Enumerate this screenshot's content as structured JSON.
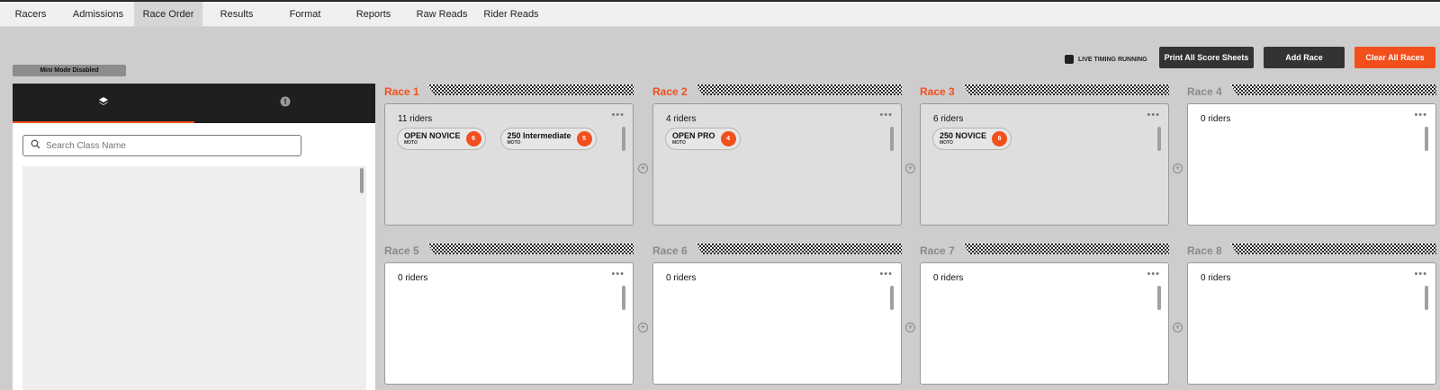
{
  "nav": {
    "items": [
      "Racers",
      "Admissions",
      "Race Order",
      "Results",
      "Format",
      "Reports",
      "Raw Reads",
      "Rider Reads"
    ],
    "active": "Race Order"
  },
  "mini_mode_label": "Mini Mode Disabled",
  "live_timing": {
    "label": "LIVE TIMING RUNNING",
    "checked": true
  },
  "toolbar": {
    "print_label": "Print All Score Sheets",
    "add_label": "Add Race",
    "clear_label": "Clear All Races"
  },
  "sidebar": {
    "tabs": [
      {
        "icon": "layers-icon"
      },
      {
        "icon": "info-icon"
      }
    ],
    "search_placeholder": "Search Class Name"
  },
  "races": [
    {
      "title": "Race 1",
      "riders": "11 riders",
      "classes": [
        {
          "name": "OPEN NOVICE",
          "type": "MOTO",
          "count": "6"
        },
        {
          "name": "250 Intermediate",
          "type": "MOTO",
          "count": "5"
        }
      ]
    },
    {
      "title": "Race 2",
      "riders": "4 riders",
      "classes": [
        {
          "name": "OPEN PRO",
          "type": "MOTO",
          "count": "4"
        }
      ]
    },
    {
      "title": "Race 3",
      "riders": "6 riders",
      "classes": [
        {
          "name": "250 NOVICE",
          "type": "MOTO",
          "count": "6"
        }
      ]
    },
    {
      "title": "Race 4",
      "riders": "0 riders",
      "classes": []
    },
    {
      "title": "Race 5",
      "riders": "0 riders",
      "classes": []
    },
    {
      "title": "Race 6",
      "riders": "0 riders",
      "classes": []
    },
    {
      "title": "Race 7",
      "riders": "0 riders",
      "classes": []
    },
    {
      "title": "Race 8",
      "riders": "0 riders",
      "classes": []
    }
  ],
  "colors": {
    "accent": "#f24f1c",
    "dark": "#333333",
    "bg": "#cdcdcd"
  }
}
